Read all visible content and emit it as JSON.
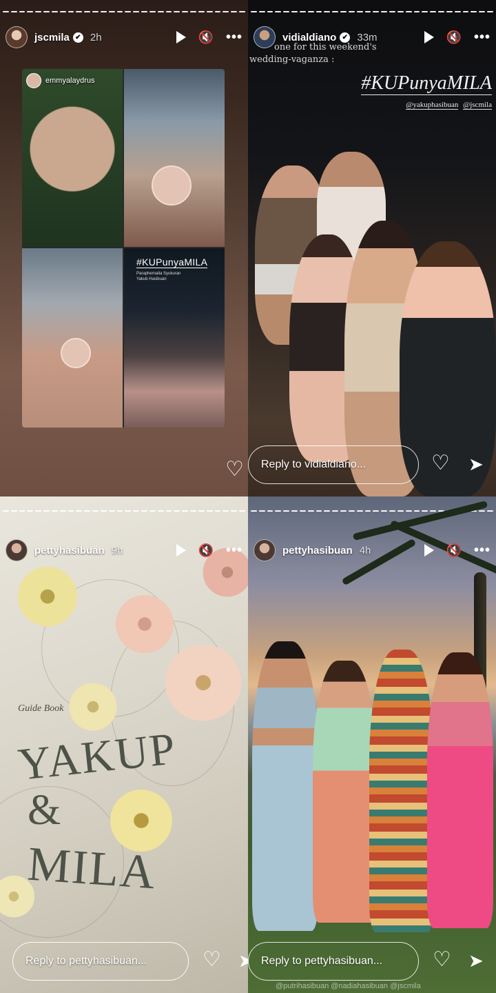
{
  "stories": [
    {
      "username": "jscmila",
      "time": "2h",
      "collage": {
        "tag_username": "emmyalaydrus",
        "hashtag": "#KUPunyaMILA",
        "small_text": [
          "Paraphernalia Syukuran",
          "Yakub Hasibuan"
        ]
      },
      "reply_placeholder": ""
    },
    {
      "username": "vidialdiano",
      "time": "33m",
      "caption_lines": [
        "one for this weekend's",
        "wedding-vaganza :"
      ],
      "hashtag": "#KUPunyaMILA",
      "mentions": [
        "@yakuphasibuan",
        "@jscmila"
      ],
      "reply_placeholder": "Reply to vidialdiano..."
    },
    {
      "username": "pettyhasibuan",
      "time": "9h",
      "guide_book_label": "Guide Book",
      "title_lines": [
        "YAKUP",
        "&",
        "MILA"
      ],
      "reply_placeholder": "Reply to pettyhasibuan..."
    },
    {
      "username": "pettyhasibuan",
      "time": "4h",
      "mentions": [
        "@putrihasibuan",
        "@nadiahasibuan",
        "@jscmila"
      ],
      "reply_placeholder": "Reply to pettyhasibuan..."
    }
  ],
  "icons": {
    "verified": "✔",
    "mute": "🔇",
    "more": "•••",
    "heart": "♡",
    "send": "➤"
  }
}
